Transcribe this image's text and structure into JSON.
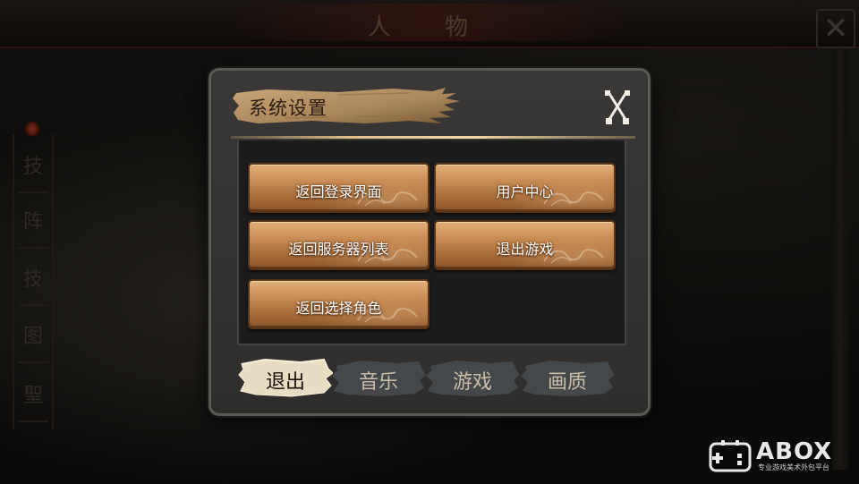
{
  "background": {
    "screen_title": "人 物",
    "close_glyph": "✕",
    "side_tabs": [
      "技",
      "阵",
      "技",
      "图",
      "聖"
    ]
  },
  "dialog": {
    "title": "系统设置",
    "close_icon": "crossed-swords-icon",
    "buttons": [
      {
        "label": "返回登录界面"
      },
      {
        "label": "用户中心"
      },
      {
        "label": "返回服务器列表"
      },
      {
        "label": "退出游戏"
      },
      {
        "label": "返回选择角色"
      }
    ],
    "tabs": [
      {
        "label": "退出",
        "active": true
      },
      {
        "label": "音乐",
        "active": false
      },
      {
        "label": "游戏",
        "active": false
      },
      {
        "label": "画质",
        "active": false
      }
    ]
  },
  "watermark": {
    "brand": "ABOX",
    "tagline": "专业游戏美术外包平台"
  },
  "colors": {
    "button_gold": "#c98d55",
    "panel_dark": "#1c1c1d",
    "dialog_frame": "#5b5955",
    "title_brush": "#a8865a"
  }
}
